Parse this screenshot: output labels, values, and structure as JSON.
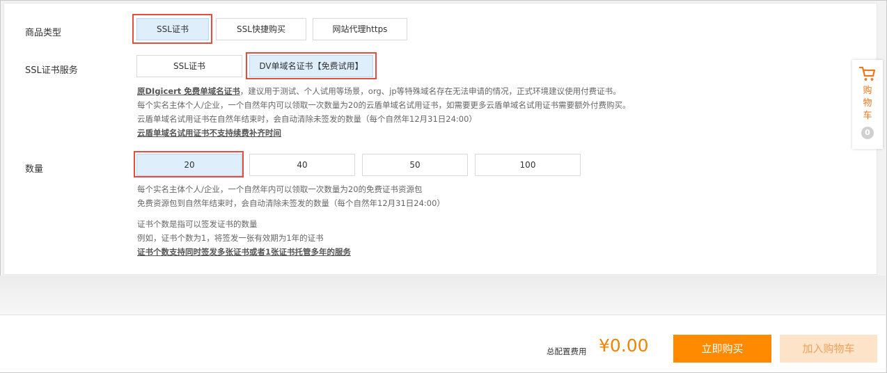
{
  "product_type": {
    "label": "商品类型",
    "options": [
      "SSL证书",
      "SSL快捷购买",
      "网站代理https"
    ],
    "selected": "SSL证书"
  },
  "ssl_service": {
    "label": "SSL证书服务",
    "options": [
      "SSL证书",
      "DV单域名证书【免费试用】"
    ],
    "selected": "DV单域名证书【免费试用】",
    "desc_lead_bold": "原DIgicert 免费单域名证书",
    "desc_lead_rest": "，建议用于测试、个人试用等场景，org、jp等特殊域名存在无法申请的情况，正式环境建议使用付费证书。",
    "desc_line2": "每个实名主体个人/企业，一个自然年内可以领取一次数量为20的云盾单域名试用证书，如需要更多云盾单域名试用证书需要额外付费购买。",
    "desc_line3": "云盾单域名试用证书在自然年结束时，会自动清除未签发的数量（每个自然年12月31日24:00）",
    "desc_link": "云盾单域名试用证书不支持续费补齐时间"
  },
  "quantity": {
    "label": "数量",
    "options": [
      "20",
      "40",
      "50",
      "100"
    ],
    "selected": "20",
    "desc_line1": "每个实名主体个人/企业，一个自然年内可以领取一次数量为20的免费证书资源包",
    "desc_line2": "免费资源包到自然年结束时，会自动清除未签发的数量（每个自然年12月31日24:00）",
    "desc_line3": "证书个数是指可以签发证书的数量",
    "desc_line4": "例如，证书个数为1，将签发一张有效期为1年的证书",
    "desc_link": "证书个数支持同时签发多张证书或者1张证书托管多年的服务"
  },
  "cart_widget": {
    "text": "购物车",
    "count": "0",
    "icon": "shopping-cart-icon"
  },
  "footer": {
    "total_label": "总配置费用",
    "price": "¥0.00",
    "buy_label": "立即购买",
    "add_cart_label": "加入购物车"
  },
  "colors": {
    "accent": "#ff8a00",
    "price": "#f08300",
    "selected_bg": "#deeefb",
    "highlight": "#e74c3c"
  }
}
